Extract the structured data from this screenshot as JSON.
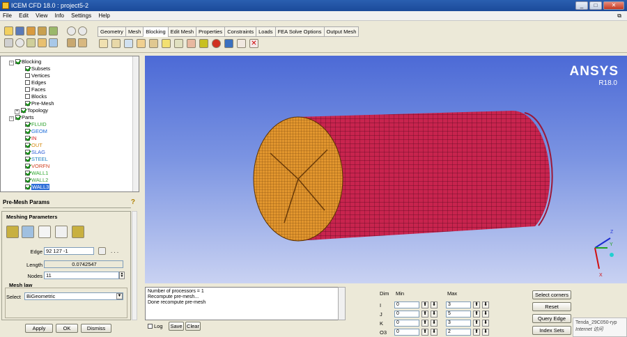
{
  "window": {
    "title": "ICEM CFD 18.0 : project5-2",
    "minimize": "_",
    "maximize": "□",
    "close": "✕",
    "restore": "⧉"
  },
  "menu": [
    "File",
    "Edit",
    "View",
    "Info",
    "Settings",
    "Help"
  ],
  "tabs": [
    "Geometry",
    "Mesh",
    "Blocking",
    "Edit Mesh",
    "Properties",
    "Constraints",
    "Loads",
    "FEA Solve Options",
    "Output Mesh"
  ],
  "active_tab": "Blocking",
  "tree": {
    "blocking": "Blocking",
    "blocking_children": [
      "Subsets",
      "Vertices",
      "Edges",
      "Faces",
      "Blocks",
      "Pre-Mesh",
      "Topology"
    ],
    "parts": "Parts",
    "part_items": [
      {
        "label": "FLUID",
        "color": "#2aa02a"
      },
      {
        "label": "GEOM",
        "color": "#1a6ad8"
      },
      {
        "label": "IN",
        "color": "#d42020"
      },
      {
        "label": "OUT",
        "color": "#d48a10"
      },
      {
        "label": "SLAG",
        "color": "#2b5cd6"
      },
      {
        "label": "STEEL",
        "color": "#1f7fbf"
      },
      {
        "label": "VORFN",
        "color": "#d04020"
      },
      {
        "label": "WALL1",
        "color": "#2fa82f"
      },
      {
        "label": "WALL2",
        "color": "#3c9a3c"
      },
      {
        "label": "WALL3",
        "color": "#ffffff"
      }
    ]
  },
  "premesh": {
    "title": "Pre-Mesh Params",
    "help": "?",
    "group": "Meshing Parameters",
    "edge_label": "Edge",
    "edge_value": "92 127 -1",
    "edge_more": ". . .",
    "length_label": "Length",
    "length_value": "0.0742547",
    "nodes_label": "Nodes",
    "nodes_value": "11",
    "meshlaw_label": "Mesh law",
    "select_label": "Select",
    "select_value": "BiGeometric"
  },
  "bottom_buttons": {
    "apply": "Apply",
    "ok": "OK",
    "dismiss": "Dismiss"
  },
  "viewport": {
    "brand": "ANSYS",
    "version": "R18.0",
    "axis_x": "X",
    "axis_y": "Y",
    "axis_z": "Z"
  },
  "console": {
    "lines": [
      "Number of processors = 1",
      "Recompute pre-mesh...",
      "Done recompute pre-mesh"
    ],
    "log_label": "Log",
    "save_label": "Save",
    "clear_label": "Clear"
  },
  "dims": {
    "headers": {
      "dim": "Dim",
      "min": "Min",
      "max": "Max"
    },
    "rows": [
      {
        "dim": "I",
        "min": "0",
        "max": "3"
      },
      {
        "dim": "J",
        "min": "0",
        "max": "5"
      },
      {
        "dim": "K",
        "min": "0",
        "max": "3"
      },
      {
        "dim": "O3",
        "min": "0",
        "max": "2"
      }
    ]
  },
  "side_buttons": [
    "Select corners",
    "Reset",
    "Query Edge",
    "Index Sets"
  ],
  "tray": {
    "line1": "Tenda_29C050-ryp",
    "line2": "Internet 访问"
  }
}
